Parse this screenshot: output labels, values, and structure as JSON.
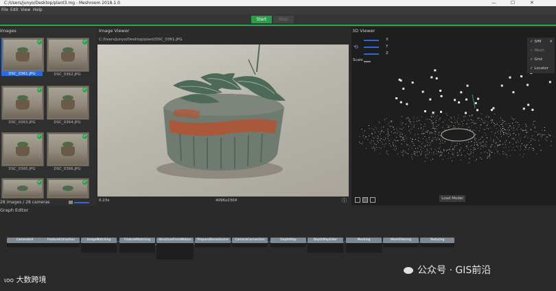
{
  "window": {
    "title": "C:/Users/junyo/Desktop/plant3.mg - Meshroom 2018.1.0"
  },
  "menu": [
    "File",
    "Edit",
    "View",
    "Help"
  ],
  "toolbar": {
    "start": "Start",
    "stop": "Stop"
  },
  "images_panel": {
    "title": "Images",
    "thumbnails": [
      {
        "label": "DSC_0361.JPG",
        "selected": true
      },
      {
        "label": "DSC_0362.JPG",
        "selected": false
      },
      {
        "label": "DSC_0363.JPG",
        "selected": false
      },
      {
        "label": "DSC_0364.JPG",
        "selected": false
      },
      {
        "label": "DSC_0365.JPG",
        "selected": false
      },
      {
        "label": "DSC_0366.JPG",
        "selected": false
      },
      {
        "label": "",
        "selected": false
      },
      {
        "label": "",
        "selected": false
      }
    ],
    "count": "28 images / 28 cameras"
  },
  "image_viewer": {
    "title": "Image Viewer",
    "path": "C:/Users/junyo/Desktop/plant/DSC_0361.JPG",
    "zoom": "0.23x",
    "resolution": "4096x2304"
  },
  "viewer_3d": {
    "title": "3D Viewer",
    "axes": [
      "X",
      "Y",
      "Z"
    ],
    "scale_label": "Scale",
    "layers": [
      "SfM",
      "Mesh",
      "Grid",
      "Locator"
    ],
    "load_model": "Load Model"
  },
  "graph_editor": {
    "title": "Graph Editor",
    "nodes": [
      "CameraInit",
      "FeatureExtraction",
      "ImageMatching",
      "FeatureMatching",
      "StructureFromMotion",
      "PrepareDenseScene",
      "CameraConnection",
      "DepthMap",
      "DepthMapFilter",
      "Meshing",
      "MeshFiltering",
      "Texturing"
    ]
  },
  "watermarks": {
    "left": "大数跨境",
    "right": "公众号 · GIS前沿"
  },
  "colors": {
    "accent": "#2da44e",
    "selection": "#2a6ad9",
    "node": "#7d8a95"
  }
}
